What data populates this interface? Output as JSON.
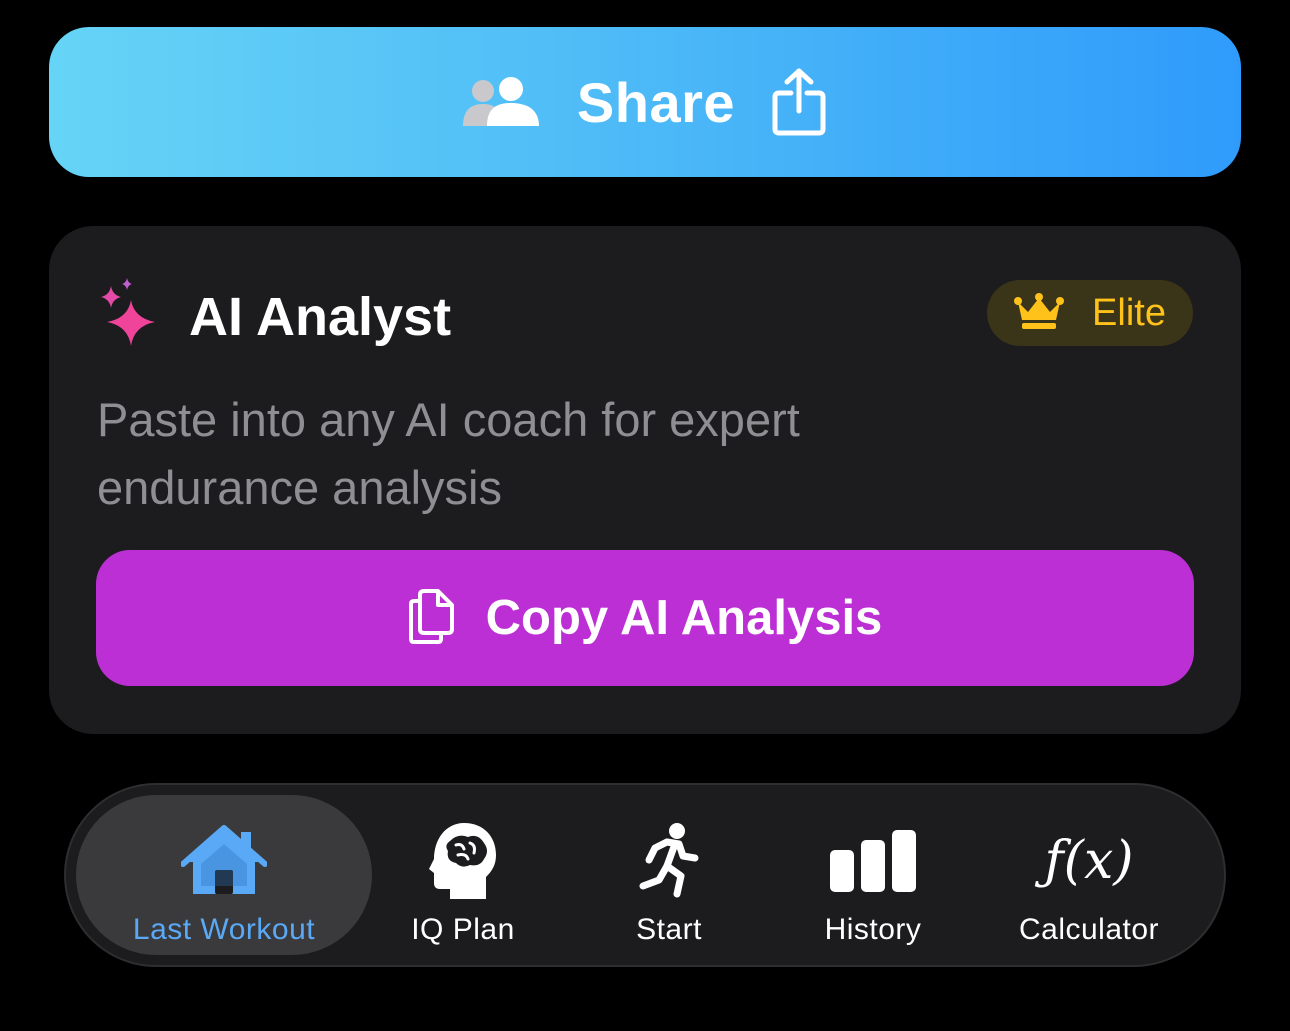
{
  "share": {
    "label": "Share",
    "left_icon": "people-icon",
    "right_icon": "share-upload-icon"
  },
  "ai_card": {
    "icon": "sparkles-icon",
    "title": "AI Analyst",
    "badge": {
      "icon": "crown-icon",
      "label": "Elite"
    },
    "description": "Paste into any AI coach for expert endurance analysis",
    "copy_button": {
      "icon": "copy-documents-icon",
      "label": "Copy AI Analysis"
    }
  },
  "tab_bar": {
    "active_index": 0,
    "tabs": [
      {
        "label": "Last Workout",
        "icon": "house-icon"
      },
      {
        "label": "IQ Plan",
        "icon": "brain-head-icon"
      },
      {
        "label": "Start",
        "icon": "runner-icon"
      },
      {
        "label": "History",
        "icon": "bar-chart-icon"
      },
      {
        "label": "Calculator",
        "icon": "function-icon",
        "icon_text": "ƒ(x)"
      }
    ]
  },
  "colors": {
    "share_gradient_start": "#66d4f6",
    "share_gradient_end": "#2f9bfb",
    "card_background": "#1c1c1e",
    "copy_button": "#bc2fd4",
    "elite_text": "#ffc21a",
    "active_tab_text": "#5aa9f7",
    "sparkle_pink": "#f0439a"
  }
}
